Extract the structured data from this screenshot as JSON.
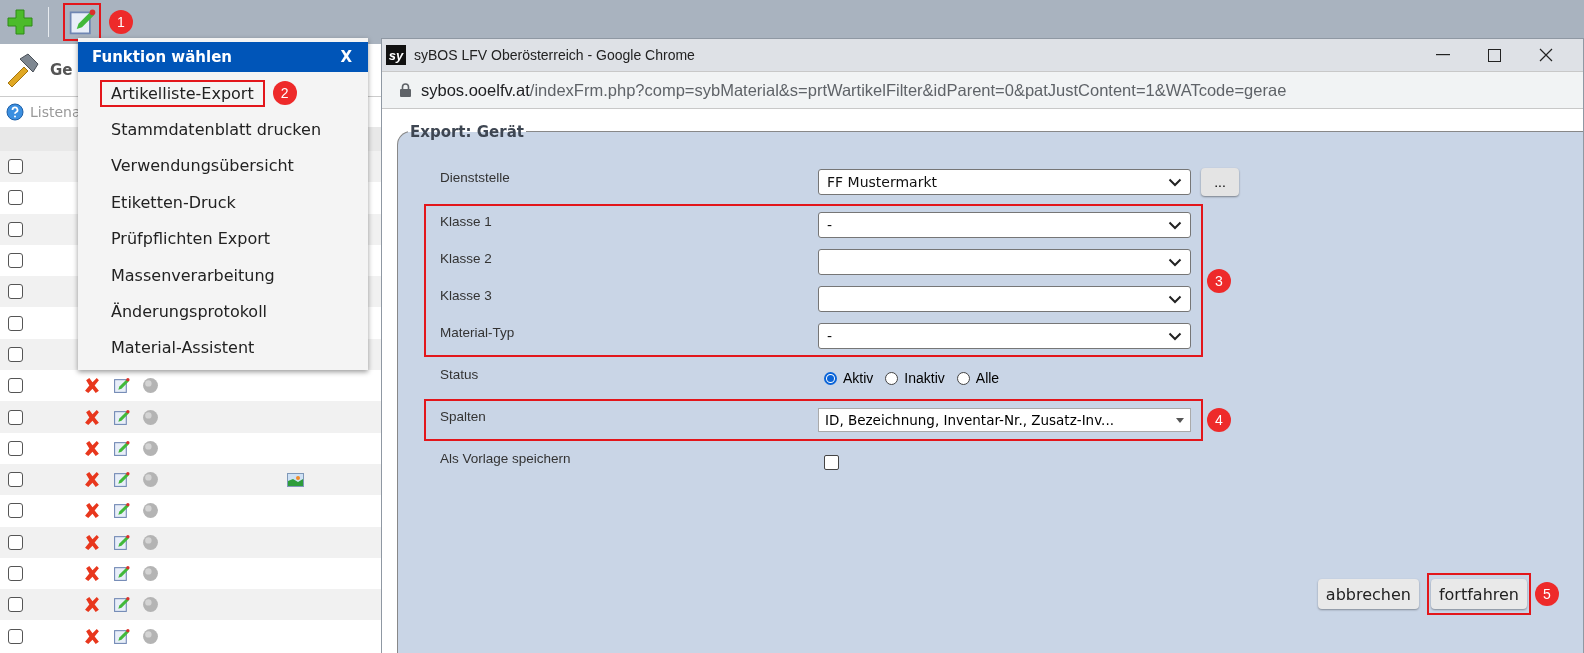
{
  "toolbar": {
    "edit_annotation": "1"
  },
  "page": {
    "title": "Ge",
    "hint": "Listena"
  },
  "rows": [
    {
      "kind": "plain",
      "checked": false
    },
    {
      "kind": "plain",
      "checked": false
    },
    {
      "kind": "plain",
      "checked": false
    },
    {
      "kind": "plain",
      "checked": false
    },
    {
      "kind": "plain",
      "checked": false
    },
    {
      "kind": "plain",
      "checked": false
    },
    {
      "kind": "plain",
      "checked": false
    },
    {
      "kind": "actions",
      "checked": false,
      "attachment": false
    },
    {
      "kind": "actions",
      "checked": false,
      "attachment": false
    },
    {
      "kind": "actions",
      "checked": false,
      "attachment": false
    },
    {
      "kind": "actions",
      "checked": false,
      "attachment": true
    },
    {
      "kind": "actions",
      "checked": false,
      "attachment": false
    },
    {
      "kind": "actions",
      "checked": false,
      "attachment": false
    },
    {
      "kind": "actions",
      "checked": false,
      "attachment": false
    },
    {
      "kind": "actions",
      "checked": false,
      "attachment": false
    },
    {
      "kind": "actions",
      "checked": false,
      "attachment": false
    }
  ],
  "menu": {
    "title": "Funktion wählen",
    "close": "X",
    "items": [
      {
        "label": "Artikelliste-Export",
        "annotation": "2"
      },
      {
        "label": "Stammdatenblatt drucken"
      },
      {
        "label": "Verwendungsübersicht"
      },
      {
        "label": "Etiketten-Druck"
      },
      {
        "label": "Prüfpflichten Export"
      },
      {
        "label": "Massenverarbeitung"
      },
      {
        "label": "Änderungsprotokoll"
      },
      {
        "label": "Material-Assistent"
      }
    ]
  },
  "window": {
    "logo": "sy",
    "title": "syBOS LFV Oberösterreich - Google Chrome",
    "url_host": "sybos.ooelfv.at",
    "url_path": "/indexFrm.php?comp=sybMaterial&s=prtWartikelFilter&idParent=0&patJustContent=1&WATcode=gerae"
  },
  "form": {
    "legend": "Export: Gerät",
    "sections": [
      {
        "framed": false,
        "fields": [
          {
            "kind": "select",
            "label": "Dienststelle",
            "value": "FF Mustermarkt",
            "button": "..."
          }
        ]
      },
      {
        "framed": true,
        "annotation": "3",
        "fields": [
          {
            "kind": "select",
            "label": "Klasse 1",
            "value": "-"
          },
          {
            "kind": "select",
            "label": "Klasse 2"
          },
          {
            "kind": "select",
            "label": "Klasse 3"
          },
          {
            "kind": "select",
            "label": "Material-Typ",
            "value": "-"
          }
        ]
      },
      {
        "framed": false,
        "fields": [
          {
            "kind": "radio",
            "label": "Status",
            "options": [
              {
                "label": "Aktiv",
                "selected": true
              },
              {
                "label": "Inaktiv",
                "selected": false
              },
              {
                "label": "Alle",
                "selected": false
              }
            ]
          }
        ]
      },
      {
        "framed": true,
        "annotation": "4",
        "fields": [
          {
            "kind": "multiselect",
            "label": "Spalten",
            "value": "ID, Bezeichnung, Inventar-Nr., Zusatz-Inv..."
          }
        ]
      },
      {
        "framed": false,
        "fields": [
          {
            "kind": "checkbox",
            "label": "Als Vorlage speichern",
            "checked": false
          }
        ]
      }
    ],
    "buttons": [
      {
        "label": "abbrechen"
      },
      {
        "label": "fortfahren",
        "annotation": "5"
      }
    ]
  }
}
